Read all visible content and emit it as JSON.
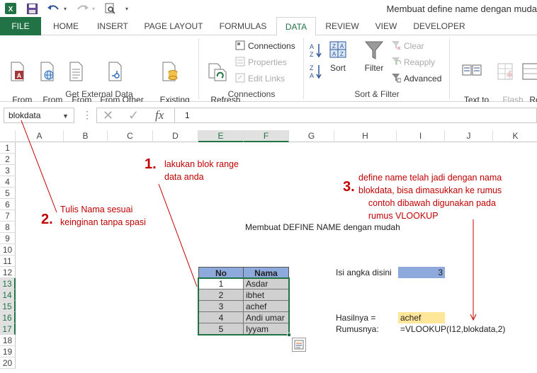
{
  "window": {
    "title": "Membuat define name dengan muda"
  },
  "qat": {
    "excel_icon": "excel-logo-icon",
    "save_icon": "save-icon",
    "undo_icon": "undo-icon",
    "redo_icon": "redo-icon",
    "preview_icon": "print-preview-icon",
    "customize_icon": "qat-customize-icon"
  },
  "tabs": [
    {
      "label": "FILE"
    },
    {
      "label": "HOME"
    },
    {
      "label": "INSERT"
    },
    {
      "label": "PAGE LAYOUT"
    },
    {
      "label": "FORMULAS"
    },
    {
      "label": "DATA"
    },
    {
      "label": "REVIEW"
    },
    {
      "label": "VIEW"
    },
    {
      "label": "DEVELOPER"
    }
  ],
  "ribbon": {
    "get_external": {
      "label": "Get External Data",
      "from_access": "From\nAccess",
      "from_web": "From\nWeb",
      "from_text": "From\nText",
      "from_other": "From Other\nSources ▾",
      "existing": "Existing\nConnections"
    },
    "connections": {
      "label": "Connections",
      "refresh": "Refresh\nAll ▾",
      "connections": "Connections",
      "properties": "Properties",
      "edit_links": "Edit Links"
    },
    "sort_filter": {
      "label": "Sort & Filter",
      "sort": "Sort",
      "filter": "Filter",
      "clear": "Clear",
      "reapply": "Reapply",
      "advanced": "Advanced"
    },
    "data_tools": {
      "text_to_columns": "Text to\nColumns",
      "flash_fill": "Flash\nFill",
      "remove_dup": "Rem\nDup"
    }
  },
  "formula_bar": {
    "name_box": "blokdata",
    "value": "1"
  },
  "columns": [
    "A",
    "B",
    "C",
    "D",
    "E",
    "F",
    "G",
    "H",
    "I",
    "J",
    "K"
  ],
  "rows": [
    "1",
    "2",
    "3",
    "4",
    "5",
    "6",
    "7",
    "8",
    "9",
    "10",
    "11",
    "12",
    "13",
    "14",
    "15",
    "16",
    "17",
    "18",
    "19",
    "20"
  ],
  "sheet": {
    "heading": "Membuat DEFINE NAME dengan mudah",
    "table": {
      "headers": [
        "No",
        "Nama"
      ],
      "rows": [
        [
          "1",
          "Asdar"
        ],
        [
          "2",
          "ibhet"
        ],
        [
          "3",
          "achef"
        ],
        [
          "4",
          "Andi umar"
        ],
        [
          "5",
          "Iyyam"
        ]
      ]
    },
    "input_label": "Isi angka disini",
    "input_value": "3",
    "result_label": "Hasilnya =",
    "result_value": "achef",
    "formula_label": "Rumusnya:",
    "formula_text": "=VLOOKUP(I12,blokdata,2)"
  },
  "annotations": {
    "n1": "1.",
    "t1": "lakukan blok range\ndata anda",
    "n2": "2.",
    "t2": "Tulis Nama sesuai\nkeinginan tanpa spasi",
    "n3": "3.",
    "t3": "define name telah jadi dengan nama\nblokdata, bisa dimasukkan ke rumus\n    contoh dibawah digunakan pada\n    rumus VLOOKUP"
  },
  "colors": {
    "excel_green": "#217346",
    "header_fill": "#8EA9DB",
    "cell_fill": "#D0D0D0",
    "input_fill": "#8EA9DB",
    "result_fill": "#FFE699",
    "annotation_red": "#C00000"
  }
}
